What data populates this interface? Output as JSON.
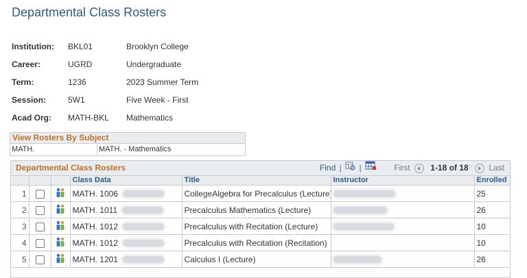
{
  "page": {
    "title": "Departmental Class Rosters"
  },
  "info": [
    {
      "label": "Institution:",
      "code": "BKL01",
      "desc": "Brooklyn College"
    },
    {
      "label": "Career:",
      "code": "UGRD",
      "desc": "Undergraduate"
    },
    {
      "label": "Term:",
      "code": "1236",
      "desc": "2023 Summer Term"
    },
    {
      "label": "Session:",
      "code": "5W1",
      "desc": "Five Week - First"
    },
    {
      "label": "Acad Org:",
      "code": "MATH-BKL",
      "desc": "Mathematics"
    }
  ],
  "subject": {
    "heading": "View Rosters By Subject",
    "code": "MATH.",
    "desc": "MATH. - Mathematics"
  },
  "grid": {
    "title": "Departmental Class Rosters",
    "find_label": "Find",
    "first_label": "First",
    "range_label": "1-18 of 18",
    "last_label": "Last",
    "columns": {
      "class_data": "Class Data",
      "title": "Title",
      "instructor": "Instructor",
      "enrolled": "Enrolled"
    },
    "rows": [
      {
        "num": "1",
        "class": "MATH.  1006",
        "title": "CollegeAlgebra for Precalculus (Lecture)",
        "enrolled": "25",
        "has_instructor": true
      },
      {
        "num": "2",
        "class": "MATH.  1011",
        "title": "Precalculus Mathematics (Lecture)",
        "enrolled": "26",
        "has_instructor": true
      },
      {
        "num": "3",
        "class": "MATH.  1012",
        "title": "Precalculus with Recitation (Lecture)",
        "enrolled": "10",
        "has_instructor": true
      },
      {
        "num": "4",
        "class": "MATH.  1012",
        "title": "Precalculus with Recitation (Recitation)",
        "enrolled": "10",
        "has_instructor": false
      },
      {
        "num": "5",
        "class": "MATH.  1201",
        "title": "Calculus I (Lecture)",
        "enrolled": "26",
        "has_instructor": true
      }
    ]
  },
  "icons": {
    "roster_icon": "people-roster-icon",
    "view_all_icon": "zoom-grid-icon",
    "download_icon": "download-spreadsheet-icon"
  },
  "colors": {
    "title_blue": "#2b5c8a",
    "section_orange": "#c2701f",
    "header_bg": "#e9ecf1"
  }
}
